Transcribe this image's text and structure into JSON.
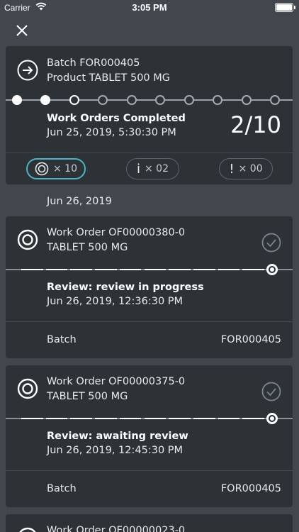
{
  "status_bar": {
    "carrier": "Carrier",
    "time": "3:05 PM"
  },
  "batch_card": {
    "batch_label": "Batch FOR000405",
    "product_label": "Product TABLET 500 MG",
    "steps_total": 10,
    "steps_done": 2,
    "steps_current": 2,
    "status_title": "Work Orders Completed",
    "status_date": "Jun 25, 2019, 5:30:30 PM",
    "count": "2/10",
    "filters": [
      {
        "label": "× 10",
        "active": true
      },
      {
        "label": "× 02",
        "active": false
      },
      {
        "label": "× 00",
        "active": false
      }
    ]
  },
  "date_header": "Jun 26, 2019",
  "work_orders": [
    {
      "title": "Work Order OF00000380-0",
      "product": "TABLET 500 MG",
      "status": "Review: review in progress",
      "date": "Jun 26, 2019, 12:36:30 PM",
      "batch_label": "Batch",
      "batch_value": "FOR000405"
    },
    {
      "title": "Work Order OF00000375-0",
      "product": "TABLET 500 MG",
      "status": "Review: awaiting review",
      "date": "Jun 26, 2019, 12:45:30 PM",
      "batch_label": "Batch",
      "batch_value": "FOR000405"
    },
    {
      "title": "Work Order OF00000023-0"
    }
  ],
  "colors": {
    "background": "#42474d",
    "card": "#2d3237",
    "accent": "#4fb3c7"
  }
}
